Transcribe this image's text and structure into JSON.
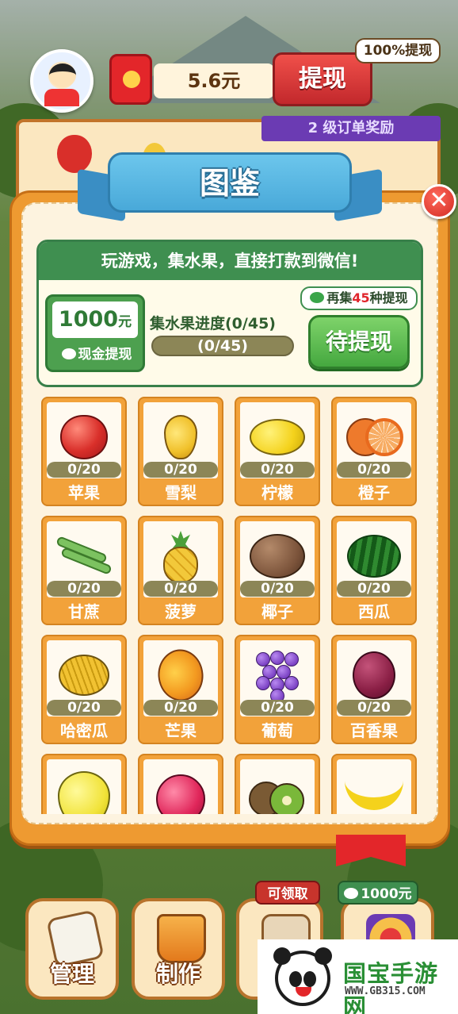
{
  "top": {
    "balance": "5.6元",
    "withdraw_label": "提现",
    "withdraw_badge": "100%提现",
    "order_reward_label": "2 级订单奖励"
  },
  "modal": {
    "title": "图鉴",
    "close_glyph": "✕",
    "banner": "玩游戏，集水果，直接打款到微信!",
    "cash_amount": "1000",
    "cash_unit": "元",
    "cash_label": "现金提现",
    "progress_label": "集水果进度(0/45)",
    "progress_text": "(0/45)",
    "progress_value": 0,
    "collect_prefix": "再集",
    "collect_count": "45",
    "collect_suffix": "种提现",
    "pending_button": "待提现"
  },
  "fruits": [
    {
      "name": "苹果",
      "count": "0/20",
      "icon": "apple-icon"
    },
    {
      "name": "雪梨",
      "count": "0/20",
      "icon": "pear-icon"
    },
    {
      "name": "柠檬",
      "count": "0/20",
      "icon": "lemon-icon"
    },
    {
      "name": "橙子",
      "count": "0/20",
      "icon": "orange-icon"
    },
    {
      "name": "甘蔗",
      "count": "0/20",
      "icon": "sugarcane-icon"
    },
    {
      "name": "菠萝",
      "count": "0/20",
      "icon": "pineapple-icon"
    },
    {
      "name": "椰子",
      "count": "0/20",
      "icon": "coconut-icon"
    },
    {
      "name": "西瓜",
      "count": "0/20",
      "icon": "watermelon-icon"
    },
    {
      "name": "哈密瓜",
      "count": "0/20",
      "icon": "hami-melon-icon"
    },
    {
      "name": "芒果",
      "count": "0/20",
      "icon": "mango-icon"
    },
    {
      "name": "葡萄",
      "count": "0/20",
      "icon": "grape-icon"
    },
    {
      "name": "百香果",
      "count": "0/20",
      "icon": "passion-fruit-icon"
    },
    {
      "name": "",
      "count": "",
      "icon": "pomelo-icon"
    },
    {
      "name": "",
      "count": "",
      "icon": "lychee-icon"
    },
    {
      "name": "",
      "count": "",
      "icon": "kiwi-icon"
    },
    {
      "name": "",
      "count": "",
      "icon": "banana-icon"
    }
  ],
  "nav": {
    "manage": "管理",
    "make": "制作",
    "claimable_tag": "可领取",
    "reward_tag": "1000元"
  },
  "watermark": {
    "brand": "国宝手游网",
    "url": "WWW.GB315.COM"
  }
}
